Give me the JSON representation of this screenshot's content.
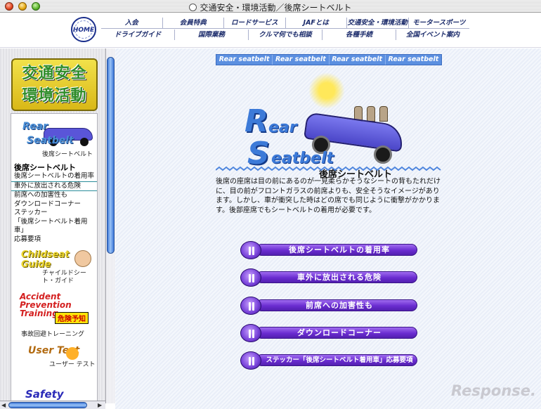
{
  "window": {
    "title": "交通安全・環境活動／後席シートベルト"
  },
  "header": {
    "home_logo": "HOME",
    "nav_row1": [
      "入会",
      "会員特典",
      "ロードサービス",
      "JAFとは",
      "交通安全・環境活動",
      "モータースポーツ"
    ],
    "nav_row2": [
      "ドライブガイド",
      "国際業務",
      "クルマ何でも相談",
      "各種手続",
      "全国イベント案内"
    ]
  },
  "sidebar": {
    "logo_line1": "交通安全",
    "logo_line2": "環境活動",
    "rear_logo_top": "Rear",
    "rear_logo_bottom": "Seatbelt",
    "rear_caption": "後席シートベルト",
    "heading": "後席シートベルト",
    "links": [
      "後席シートベルトの着用率",
      "車外に放出される危険",
      "前席への加害性も",
      "ダウンロードコーナー",
      "ステッカー",
      "「後席シートベルト着用車」",
      "応募要項"
    ],
    "childseat_title": "Childseat Guide",
    "childseat_caption": "チャイルドシート・ガイド",
    "accident_title": "Accident Prevention Training",
    "accident_badge": "危険予知",
    "accident_caption": "事故回避トレーニング",
    "user_title": "User Test",
    "user_caption": "ユーザー テスト",
    "safety_title": "Safety"
  },
  "main": {
    "tabs": [
      "Rear seatbelt",
      "Rear seatbelt",
      "Rear seatbelt",
      "Rear seatbelt"
    ],
    "hero_title_1": "R",
    "hero_title_2": "ear",
    "hero_title_3": "S",
    "hero_title_4": "eatbelt",
    "hero_subtitle": "後席シートベルト",
    "paragraph": "後席の座席は目の前にあるのが一見柔らかそうなシートの背もたれだけに、目の前がフロントガラスの前席よりも、安全そうなイメージがあります。しかし、車が衝突した時はどの席でも同じように衝撃がかかります。後部座席でもシートベルトの着用が必要です。",
    "menu": [
      "後席シートベルトの着用率",
      "車外に放出される危険",
      "前席への加害性も",
      "ダウンロードコーナー",
      "ステッカー「後席シートベルト着用車」応募要項"
    ],
    "watermark": "Response."
  }
}
